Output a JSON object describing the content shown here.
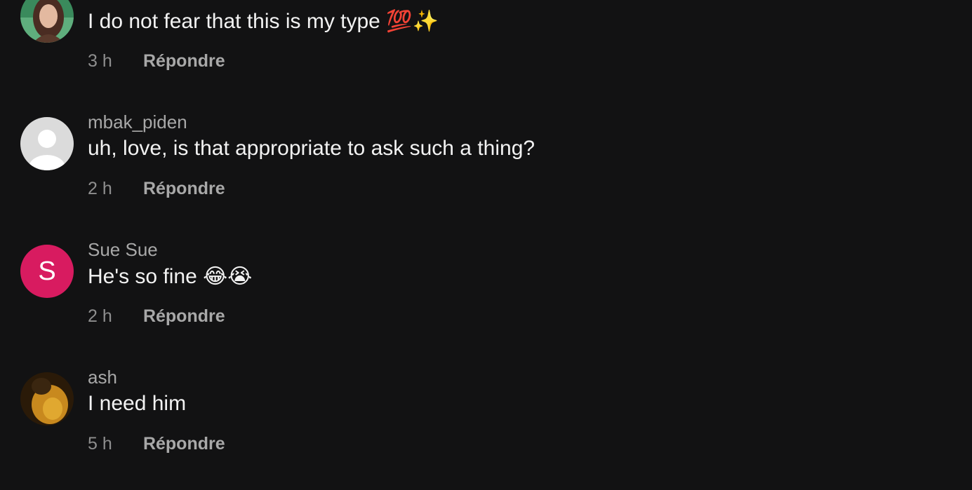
{
  "comments": [
    {
      "username": "",
      "avatar": {
        "type": "photo",
        "icon": "user-photo-avatar"
      },
      "text": "I do not fear that this is my type 💯✨",
      "time": "3 h",
      "reply_label": "Répondre"
    },
    {
      "username": "mbak_piden",
      "avatar": {
        "type": "default",
        "icon": "default-user-icon"
      },
      "text": "uh, love, is that appropriate to ask such a thing?",
      "time": "2 h",
      "reply_label": "Répondre"
    },
    {
      "username": "Sue Sue",
      "avatar": {
        "type": "letter",
        "letter": "S",
        "color": "#d81b60"
      },
      "text": "He's so fine 😂😭",
      "time": "2 h",
      "reply_label": "Répondre"
    },
    {
      "username": "ash",
      "avatar": {
        "type": "photo",
        "icon": "user-photo-avatar"
      },
      "text": "I need him",
      "time": "5 h",
      "reply_label": "Répondre"
    }
  ],
  "colors": {
    "background": "#121213",
    "text": "#f2f2f2",
    "username": "#a8a8a8",
    "time": "#8e8e8e"
  }
}
